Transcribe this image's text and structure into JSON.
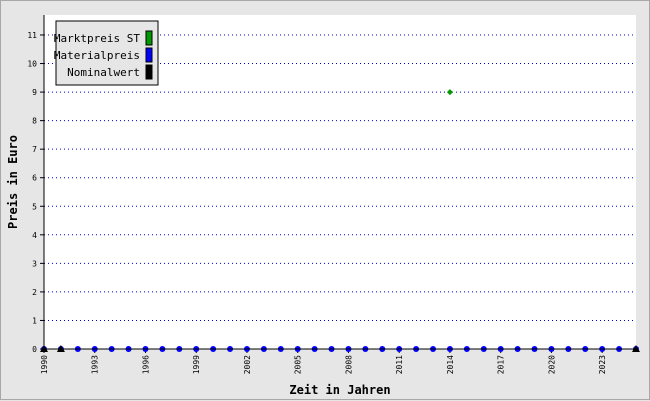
{
  "chart_data": {
    "type": "line",
    "title": "",
    "xlabel": "Zeit in Jahren",
    "ylabel": "Preis in Euro",
    "xlim": [
      1990,
      2025
    ],
    "ylim": [
      0,
      11.7
    ],
    "grid": {
      "horizontal": true,
      "vertical": false,
      "style": "dotted"
    },
    "legend_position": "top-left",
    "x_tick_labels": [
      "1990",
      "1993",
      "1996",
      "1999",
      "2002",
      "2005",
      "2008",
      "2011",
      "2014",
      "2017",
      "2020",
      "2023"
    ],
    "y_tick_labels": [
      "0",
      "1",
      "2",
      "3",
      "4",
      "5",
      "6",
      "7",
      "8",
      "9",
      "10",
      "11"
    ],
    "x": [
      1990,
      1991,
      1992,
      1993,
      1994,
      1995,
      1996,
      1997,
      1998,
      1999,
      2000,
      2001,
      2002,
      2003,
      2004,
      2005,
      2006,
      2007,
      2008,
      2009,
      2010,
      2011,
      2012,
      2013,
      2014,
      2015,
      2016,
      2017,
      2018,
      2019,
      2020,
      2021,
      2022,
      2023,
      2024,
      2025
    ],
    "series": [
      {
        "name": "Marktpreis ST",
        "color": "#009900",
        "marker": "diamond",
        "connected": false,
        "points": [
          {
            "x": 2014,
            "y": 9
          }
        ]
      },
      {
        "name": "Materialpreis",
        "color": "#0000ff",
        "marker": "circle",
        "connected": true,
        "values": [
          0,
          0,
          0,
          0,
          0,
          0,
          0,
          0,
          0,
          0,
          0,
          0,
          0,
          0,
          0,
          0,
          0,
          0,
          0,
          0,
          0,
          0,
          0,
          0,
          0,
          0,
          0,
          0,
          0,
          0,
          0,
          0,
          0,
          0,
          0,
          0
        ]
      },
      {
        "name": "Nominalwert",
        "color": "#000000",
        "marker": "triangle",
        "connected": true,
        "points": [
          {
            "x": 1990,
            "y": 0
          },
          {
            "x": 1991,
            "y": 0
          },
          {
            "x": 2025,
            "y": 0
          }
        ]
      }
    ]
  }
}
